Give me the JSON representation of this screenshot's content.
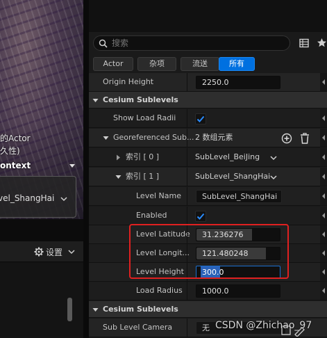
{
  "viewport": {
    "text_line_1": "的Actor",
    "text_line_2": "久性)",
    "context_label": "ontext",
    "combo_value": "vel_ShangHai"
  },
  "left_toolbar": {
    "settings_label": "设置"
  },
  "search": {
    "placeholder": "搜索"
  },
  "filters": [
    {
      "label": "Actor",
      "active": false
    },
    {
      "label": "杂项",
      "active": false
    },
    {
      "label": "流送",
      "active": false
    },
    {
      "label": "所有",
      "active": true
    }
  ],
  "rows": {
    "origin_height": {
      "label": "Origin Height",
      "value": "2250.0"
    },
    "cat_sublevels_1": {
      "label": "Cesium Sublevels"
    },
    "show_load_radii": {
      "label": "Show Load Radii",
      "checked": true
    },
    "georef_sub": {
      "label": "Georeferenced Sub...",
      "value": "2 数组元素"
    },
    "index_0": {
      "label": "索引 [ 0 ]",
      "value": "SubLevel_BeiJing"
    },
    "index_1": {
      "label": "索引 [ 1 ]",
      "value": "SubLevel_ShangHai"
    },
    "level_name": {
      "label": "Level Name",
      "value": "SubLevel_ShangHai"
    },
    "enabled": {
      "label": "Enabled",
      "checked": true
    },
    "level_latitude": {
      "label": "Level Latitude",
      "value": "31.236276"
    },
    "level_longitude": {
      "label": "Level Longit...",
      "value": "121.480248"
    },
    "level_height": {
      "label": "Level Height",
      "value": "300.0"
    },
    "load_radius": {
      "label": "Load Radius",
      "value": "1000.0"
    },
    "cat_sublevels_2": {
      "label": "Cesium Sublevels"
    },
    "sub_level_camera": {
      "label": "Sub Level Camera",
      "value": "无"
    }
  },
  "watermark": "CSDN @Zhichao_97",
  "colors": {
    "accent": "#0070e0",
    "highlight_border": "#e02020",
    "selection": "#2a62b8"
  }
}
